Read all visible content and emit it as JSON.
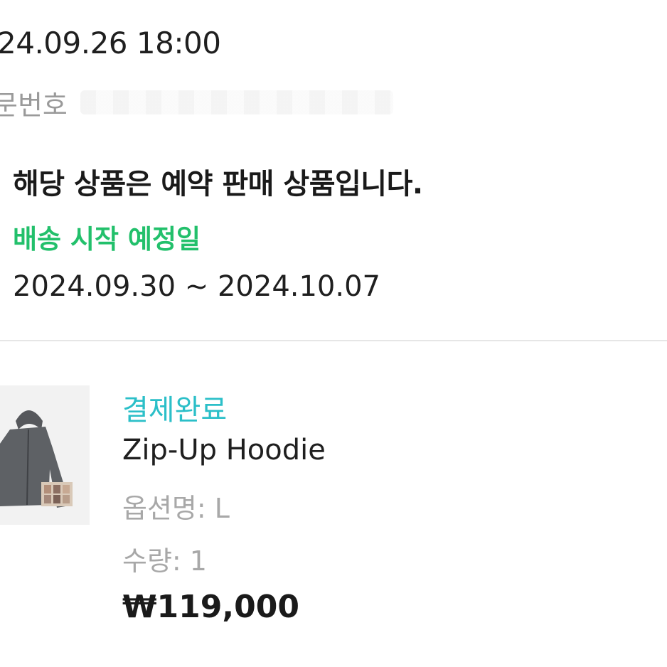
{
  "order": {
    "date": "24.09.26 18:00",
    "number_label": "문번호"
  },
  "notice": {
    "title": "해당 상품은 예약 판매 상품입니다.",
    "shipping_label": "배송 시작 예정일",
    "shipping_range": "2024.09.30 ~ 2024.10.07"
  },
  "item": {
    "status": "결제완료",
    "name": "Zip-Up Hoodie",
    "option_label": "옵션명: L",
    "quantity_label": "수량: 1",
    "price": "₩119,000",
    "image_icon": "hoodie-image"
  },
  "colors": {
    "status": "#2bbfc8",
    "shipping_label": "#22c06b",
    "muted": "#a8a8a8"
  }
}
